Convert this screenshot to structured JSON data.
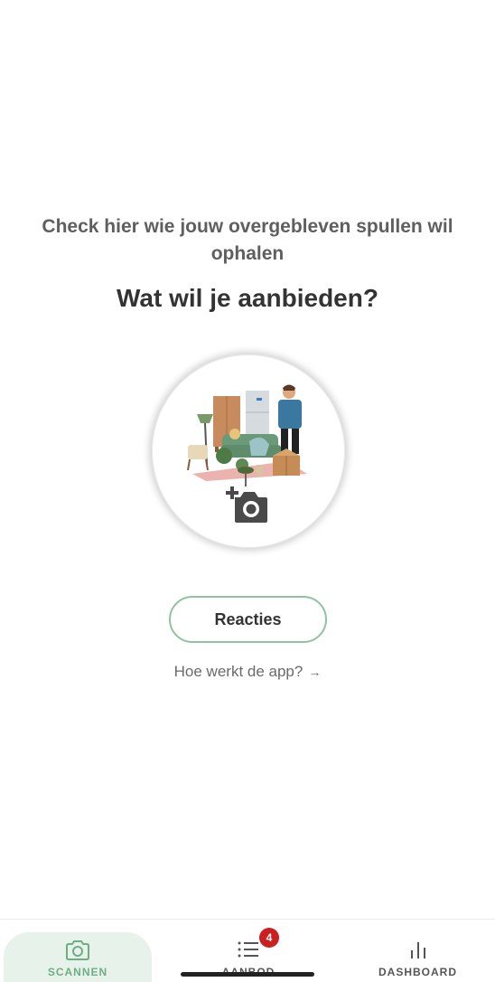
{
  "header": {
    "subtitle": "Check hier wie jouw overgebleven spullen wil ophalen",
    "title": "Wat wil je aanbieden?"
  },
  "scan_area": {
    "illustration": "furniture-and-person-illustration",
    "icon": "camera-add-icon"
  },
  "actions": {
    "reacties_label": "Reacties",
    "how_link_label": "Hoe werkt de app?",
    "how_link_arrow": "→"
  },
  "bottom_nav": {
    "items": [
      {
        "label": "SCANNEN",
        "icon": "camera-icon",
        "active": true
      },
      {
        "label": "AANBOD",
        "icon": "list-icon",
        "active": false,
        "badge": "4"
      },
      {
        "label": "DASHBOARD",
        "icon": "bar-chart-icon",
        "active": false
      }
    ]
  },
  "colors": {
    "accent": "#6fae84",
    "active_tab_bg": "#e7f2ea",
    "button_border": "#8fc3a0",
    "badge": "#cc1f1f",
    "title_text": "#333333"
  }
}
